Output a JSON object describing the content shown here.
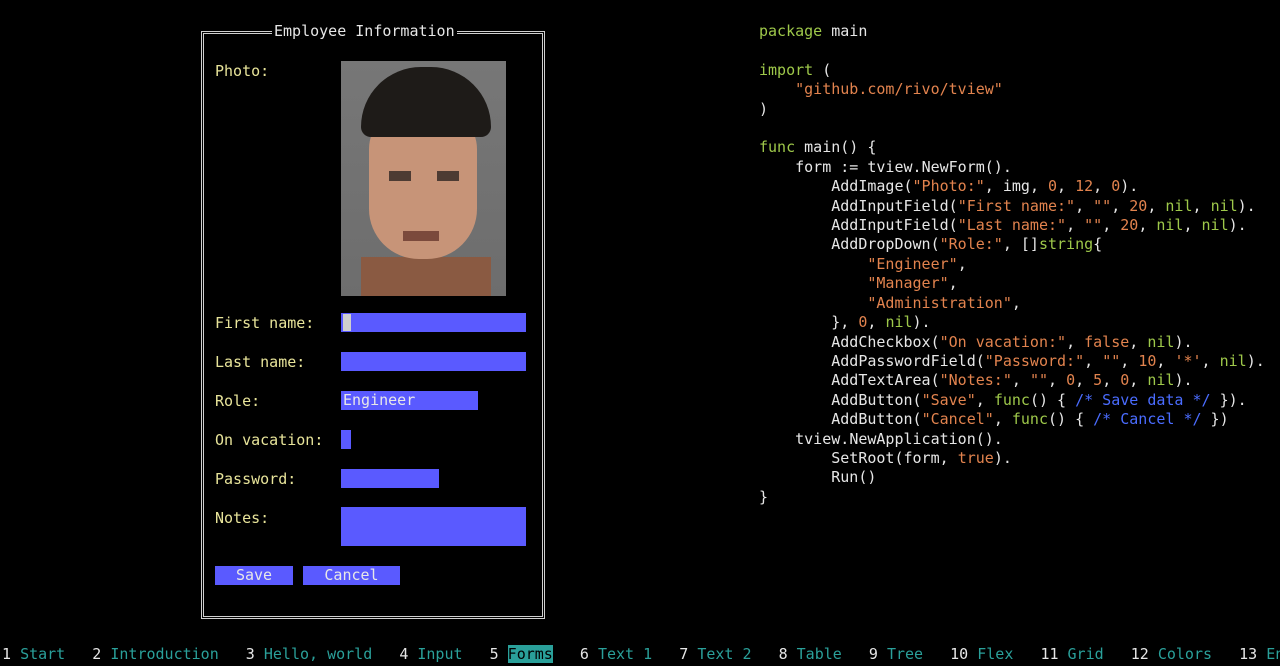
{
  "form": {
    "title": "Employee Information",
    "photo_label": "Photo:",
    "first_name_label": "First name:",
    "last_name_label": "Last name:",
    "role_label": "Role:",
    "role_value": "Engineer",
    "on_vacation_label": "On vacation:",
    "password_label": "Password:",
    "notes_label": "Notes:",
    "save_label": "Save",
    "cancel_label": "Cancel"
  },
  "code": {
    "lines": [
      "package main",
      "",
      "import (",
      "    \"github.com/rivo/tview\"",
      ")",
      "",
      "func main() {",
      "    form := tview.NewForm().",
      "        AddImage(\"Photo:\", img, 0, 12, 0).",
      "        AddInputField(\"First name:\", \"\", 20, nil, nil).",
      "        AddInputField(\"Last name:\", \"\", 20, nil, nil).",
      "        AddDropDown(\"Role:\", []string{",
      "            \"Engineer\",",
      "            \"Manager\",",
      "            \"Administration\",",
      "        }, 0, nil).",
      "        AddCheckbox(\"On vacation:\", false, nil).",
      "        AddPasswordField(\"Password:\", \"\", 10, '*', nil).",
      "        AddTextArea(\"Notes:\", \"\", 0, 5, 0, nil).",
      "        AddButton(\"Save\", func() { /* Save data */ }).",
      "        AddButton(\"Cancel\", func() { /* Cancel */ })",
      "    tview.NewApplication().",
      "        SetRoot(form, true).",
      "        Run()",
      "}"
    ]
  },
  "nav": {
    "items": [
      {
        "num": "1",
        "label": "Start"
      },
      {
        "num": "2",
        "label": "Introduction"
      },
      {
        "num": "3",
        "label": "Hello, world"
      },
      {
        "num": "4",
        "label": "Input"
      },
      {
        "num": "5",
        "label": "Forms",
        "active": true
      },
      {
        "num": "6",
        "label": "Text 1"
      },
      {
        "num": "7",
        "label": "Text 2"
      },
      {
        "num": "8",
        "label": "Table"
      },
      {
        "num": "9",
        "label": "Tree"
      },
      {
        "num": "10",
        "label": "Flex"
      },
      {
        "num": "11",
        "label": "Grid"
      },
      {
        "num": "12",
        "label": "Colors"
      },
      {
        "num": "13",
        "label": "End"
      }
    ]
  },
  "colors": {
    "field_bg": "#5a5aff",
    "label": "#e8e49a",
    "nav_label": "#2aa09a",
    "keyword": "#9ec84a",
    "string": "#e2834e",
    "comment": "#4a6cff"
  }
}
